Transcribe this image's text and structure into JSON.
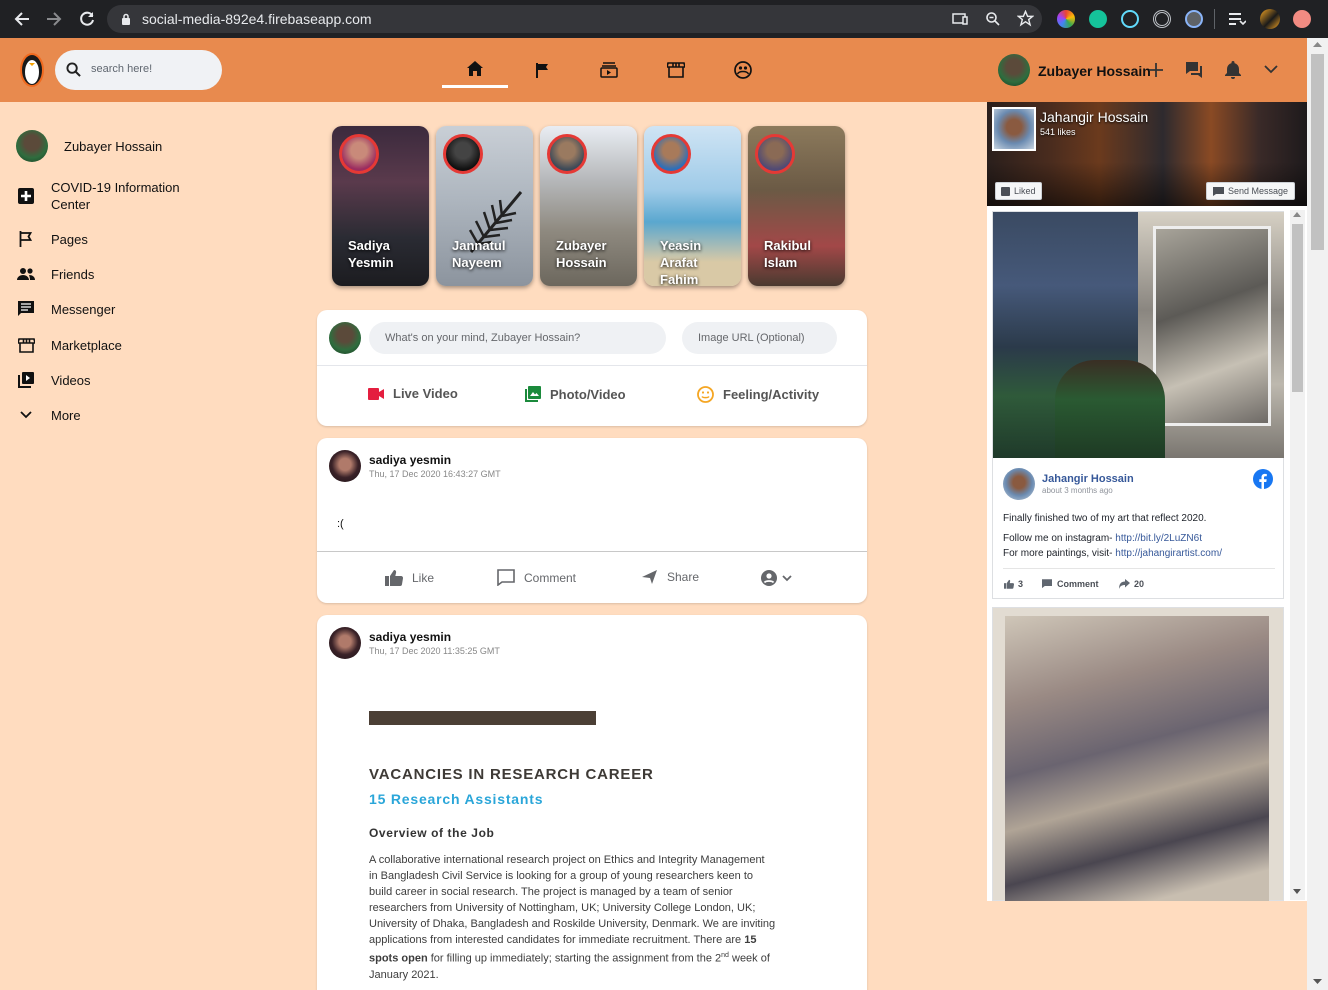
{
  "browser": {
    "url": "social-media-892e4.firebaseapp.com"
  },
  "header": {
    "search_placeholder": "search here!",
    "user_name": "Zubayer Hossain",
    "nav_items": [
      "home",
      "pages",
      "watch",
      "marketplace",
      "groups"
    ]
  },
  "sidebar": {
    "user_name": "Zubayer Hossain",
    "items": [
      {
        "label": "COVID-19 Information Center",
        "icon": "plus-box-icon"
      },
      {
        "label": "Pages",
        "icon": "flag-icon"
      },
      {
        "label": "Friends",
        "icon": "people-icon"
      },
      {
        "label": "Messenger",
        "icon": "chat-icon"
      },
      {
        "label": "Marketplace",
        "icon": "store-icon"
      },
      {
        "label": "Videos",
        "icon": "video-library-icon"
      },
      {
        "label": "More",
        "icon": "chevron-down-icon"
      }
    ]
  },
  "stories": [
    {
      "name": "Sadiya Yesmin"
    },
    {
      "name": "Jannatul Nayeem"
    },
    {
      "name": "Zubayer Hossain"
    },
    {
      "name": "Yeasin Arafat Fahim"
    },
    {
      "name": "Rakibul Islam"
    }
  ],
  "composer": {
    "text_placeholder": "What's on your mind, Zubayer Hossain?",
    "image_placeholder": "Image URL (Optional)",
    "actions": [
      {
        "label": "Live Video",
        "icon": "video-camera-icon"
      },
      {
        "label": "Photo/Video",
        "icon": "photo-icon"
      },
      {
        "label": "Feeling/Activity",
        "icon": "smiley-icon"
      }
    ]
  },
  "posts": [
    {
      "author": "sadiya yesmin",
      "time": "Thu, 17 Dec 2020 16:43:27 GMT",
      "text": ":(",
      "actions": [
        "Like",
        "Comment",
        "Share"
      ]
    },
    {
      "author": "sadiya yesmin",
      "time": "Thu, 17 Dec 2020 11:35:25 GMT",
      "document": {
        "heading": "VACANCIES IN RESEARCH CAREER",
        "subheading": "15 Research Assistants",
        "section": "Overview of the Job",
        "lines": [
          "A collaborative international research project on Ethics and Integrity Management",
          "in Bangladesh Civil Service is looking for a group of young researchers keen to",
          "build career in social research. The project is managed by a team of senior",
          "researchers from University of Nottingham, UK; University College London, UK;",
          "University of Dhaka, Bangladesh and Roskilde University, Denmark. We are inviting",
          "applications from interested candidates for immediate recruitment. There are"
        ],
        "bold_inline": "15",
        "line7_bold": "spots open",
        "line7_rest": " for filling up immediately; starting the assignment from the 2",
        "line7_sup": "nd",
        "line7_end": " week of",
        "line8": "January 2021."
      }
    }
  ],
  "fb_widget": {
    "page_name": "Jahangir Hossain",
    "likes": "541 likes",
    "liked_label": "Liked",
    "send_message_label": "Send Message",
    "post": {
      "author": "Jahangir Hossain",
      "time": "about 3 months ago",
      "text1": "Finally finished two of my art that reflect 2020.",
      "text2_prefix": "Follow me on instagram- ",
      "text2_link": "http://bit.ly/2LuZN6t",
      "text3_prefix": "For more paintings, visit- ",
      "text3_link": "http://jahangirartist.com/",
      "like_count": "3",
      "comment_label": "Comment",
      "share_count": "20"
    }
  },
  "colors": {
    "header": "#e88a4e",
    "background": "#ffdcbf",
    "story_ring": "#e53935",
    "facebook_blue": "#1877f2"
  }
}
